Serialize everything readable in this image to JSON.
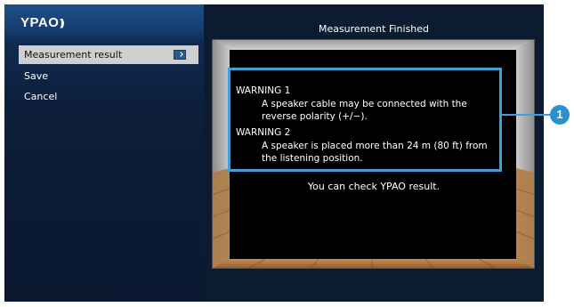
{
  "logo": {
    "text": "YPAO",
    "waves": ")))"
  },
  "sidebar": {
    "items": [
      {
        "label": "Measurement result",
        "selected": true,
        "icon": "return-icon"
      },
      {
        "label": "Save",
        "selected": false
      },
      {
        "label": "Cancel",
        "selected": false
      }
    ]
  },
  "main": {
    "title": "Measurement Finished",
    "warnings": [
      {
        "heading": "WARNING 1",
        "text": "A speaker cable may be connected with the reverse polarity (+/−)."
      },
      {
        "heading": "WARNING 2",
        "text": "A speaker is placed more than 24 m (80 ft) from the listening position."
      }
    ],
    "footer": "You can check YPAO result."
  },
  "callout": {
    "number": "1"
  },
  "colors": {
    "accent": "#3f9dd8",
    "sidebar_top": "#1e4f8a",
    "selected_bg": "#cfcfcf",
    "panel_bg": "#000000"
  }
}
